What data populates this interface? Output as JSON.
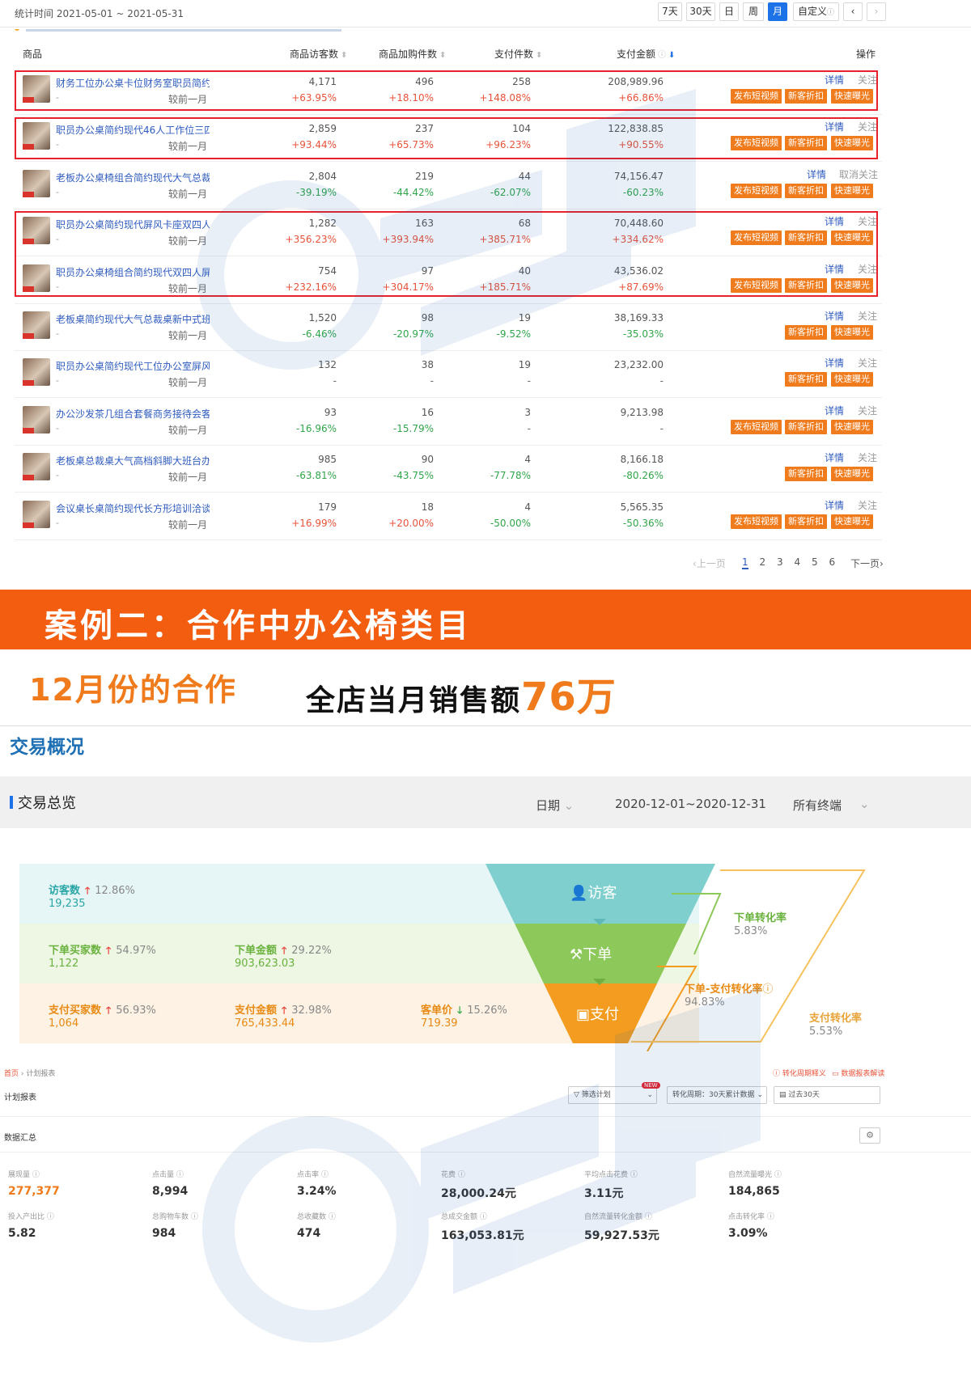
{
  "header": {
    "stat_time": "统计时间 2021-05-01 ~ 2021-05-31",
    "ranges": [
      "7天",
      "30天",
      "日",
      "周",
      "月",
      "自定义"
    ],
    "active_range": "月",
    "prev_icon": "chevron-left-icon",
    "next_icon": "chevron-right-icon"
  },
  "table": {
    "columns": [
      "商品",
      "商品访客数",
      "商品加购件数",
      "支付件数",
      "支付金额",
      "操作"
    ],
    "compare_label": "较前一月",
    "dash": "-",
    "detail_label": "详情",
    "btn_video": "发布短视频",
    "btn_discount": "新客折扣",
    "btn_exposure": "快速曝光",
    "rows": [
      {
        "name": "财务工位办公桌卡位财务室职员简约...",
        "visitors": "4,171",
        "visitors_chg": "+63.95%",
        "cart": "496",
        "cart_chg": "+18.10%",
        "paid_qty": "258",
        "paid_qty_chg": "+148.08%",
        "paid_amt": "208,989.96",
        "paid_amt_chg": "+66.86%",
        "follow": "关注",
        "video": true
      },
      {
        "name": "职员办公桌简约现代46人工作位三四...",
        "visitors": "2,859",
        "visitors_chg": "+93.44%",
        "cart": "237",
        "cart_chg": "+65.73%",
        "paid_qty": "104",
        "paid_qty_chg": "+96.23%",
        "paid_amt": "122,838.85",
        "paid_amt_chg": "+90.55%",
        "follow": "关注",
        "video": true
      },
      {
        "name": "老板办公桌椅组合简约现代大气总裁...",
        "visitors": "2,804",
        "visitors_chg": "-39.19%",
        "cart": "219",
        "cart_chg": "-44.42%",
        "paid_qty": "44",
        "paid_qty_chg": "-62.07%",
        "paid_amt": "74,156.47",
        "paid_amt_chg": "-60.23%",
        "follow": "取消关注",
        "video": true
      },
      {
        "name": "职员办公桌简约现代屏风卡座双四人...",
        "visitors": "1,282",
        "visitors_chg": "+356.23%",
        "cart": "163",
        "cart_chg": "+393.94%",
        "paid_qty": "68",
        "paid_qty_chg": "+385.71%",
        "paid_amt": "70,448.60",
        "paid_amt_chg": "+334.62%",
        "follow": "关注",
        "video": true
      },
      {
        "name": "职员办公桌椅组合简约现代双四人屏...",
        "visitors": "754",
        "visitors_chg": "+232.16%",
        "cart": "97",
        "cart_chg": "+304.17%",
        "paid_qty": "40",
        "paid_qty_chg": "+185.71%",
        "paid_amt": "43,536.02",
        "paid_amt_chg": "+87.69%",
        "follow": "关注",
        "video": true
      },
      {
        "name": "老板桌简约现代大气总裁桌新中式班...",
        "visitors": "1,520",
        "visitors_chg": "-6.46%",
        "cart": "98",
        "cart_chg": "-20.97%",
        "paid_qty": "19",
        "paid_qty_chg": "-9.52%",
        "paid_amt": "38,169.33",
        "paid_amt_chg": "-35.03%",
        "follow": "关注",
        "video": false
      },
      {
        "name": "职员办公桌简约现代工位办公室屏风...",
        "visitors": "132",
        "visitors_chg": "-",
        "cart": "38",
        "cart_chg": "-",
        "paid_qty": "19",
        "paid_qty_chg": "-",
        "paid_amt": "23,232.00",
        "paid_amt_chg": "-",
        "follow": "关注",
        "video": false
      },
      {
        "name": "办公沙发茶几组合套餐商务接待会客...",
        "visitors": "93",
        "visitors_chg": "-16.96%",
        "cart": "16",
        "cart_chg": "-15.79%",
        "paid_qty": "3",
        "paid_qty_chg": "-",
        "paid_amt": "9,213.98",
        "paid_amt_chg": "-",
        "follow": "关注",
        "video": true
      },
      {
        "name": "老板桌总裁桌大气高档斜脚大班台办...",
        "visitors": "985",
        "visitors_chg": "-63.81%",
        "cart": "90",
        "cart_chg": "-43.75%",
        "paid_qty": "4",
        "paid_qty_chg": "-77.78%",
        "paid_amt": "8,166.18",
        "paid_amt_chg": "-80.26%",
        "follow": "关注",
        "video": false
      },
      {
        "name": "会议桌长桌简约现代长方形培训洽谈...",
        "visitors": "179",
        "visitors_chg": "+16.99%",
        "cart": "18",
        "cart_chg": "+20.00%",
        "paid_qty": "4",
        "paid_qty_chg": "-50.00%",
        "paid_amt": "5,565.35",
        "paid_amt_chg": "-50.36%",
        "follow": "关注",
        "video": true
      }
    ]
  },
  "pagination": {
    "prev": "上一页",
    "pages": [
      "1",
      "2",
      "3",
      "4",
      "5",
      "6"
    ],
    "current": "1",
    "next": "下一页"
  },
  "banner": {
    "text": "案例二：合作中办公椅类目"
  },
  "case": {
    "month": "12月份的合作",
    "sales_prefix": "全店当月销售额",
    "sales_value": "76万"
  },
  "trade": {
    "title": "交易概况",
    "overview_title": "交易总览",
    "date_label": "日期",
    "date_range": "2020-12-01~2020-12-31",
    "terminal": "所有终端",
    "visitors": {
      "label": "访客数",
      "pct": "12.86%",
      "value": "19,235"
    },
    "order_buyers": {
      "label": "下单买家数",
      "pct": "54.97%",
      "value": "1,122"
    },
    "order_amount": {
      "label": "下单金额",
      "pct": "29.22%",
      "value": "903,623.03"
    },
    "pay_buyers": {
      "label": "支付买家数",
      "pct": "56.93%",
      "value": "1,064"
    },
    "pay_amount": {
      "label": "支付金额",
      "pct": "32.98%",
      "value": "765,433.44"
    },
    "unit_price": {
      "label": "客单价",
      "pct": "15.26%",
      "value": "719.39"
    },
    "funnel": {
      "visit": "访客",
      "order": "下单",
      "pay": "支付"
    },
    "rates": {
      "order_rate_label": "下单转化率",
      "order_rate": "5.83%",
      "order_pay_label": "下单-支付转化率",
      "order_pay": "94.83%",
      "pay_rate_label": "支付转化率",
      "pay_rate": "5.53%"
    },
    "colors": {
      "visit": "#7fcfcf",
      "order": "#8dc85a",
      "pay": "#f39c1f"
    }
  },
  "plan": {
    "breadcrumb_home": "首页",
    "breadcrumb_current": "计划报表",
    "help1": "转化周期释义",
    "help2": "数据报表解读",
    "title": "计划报表",
    "filter": "筛选计划",
    "new_badge": "NEW",
    "cycle": "转化周期：30天累计数据",
    "period": "过去30天",
    "summary_title": "数据汇总",
    "kpis": [
      {
        "label": "展现量",
        "value": "277,377"
      },
      {
        "label": "点击量",
        "value": "8,994"
      },
      {
        "label": "点击率",
        "value": "3.24%"
      },
      {
        "label": "花费",
        "value": "28,000.24元"
      },
      {
        "label": "平均点击花费",
        "value": "3.11元"
      },
      {
        "label": "自然流量曝光",
        "value": "184,865"
      },
      {
        "label": "投入产出比",
        "value": "5.82"
      },
      {
        "label": "总购物车数",
        "value": "984"
      },
      {
        "label": "总收藏数",
        "value": "474"
      },
      {
        "label": "总成交金额",
        "value": "163,053.81元"
      },
      {
        "label": "自然流量转化金额",
        "value": "59,927.53元"
      },
      {
        "label": "点击转化率",
        "value": "3.09%"
      }
    ]
  }
}
